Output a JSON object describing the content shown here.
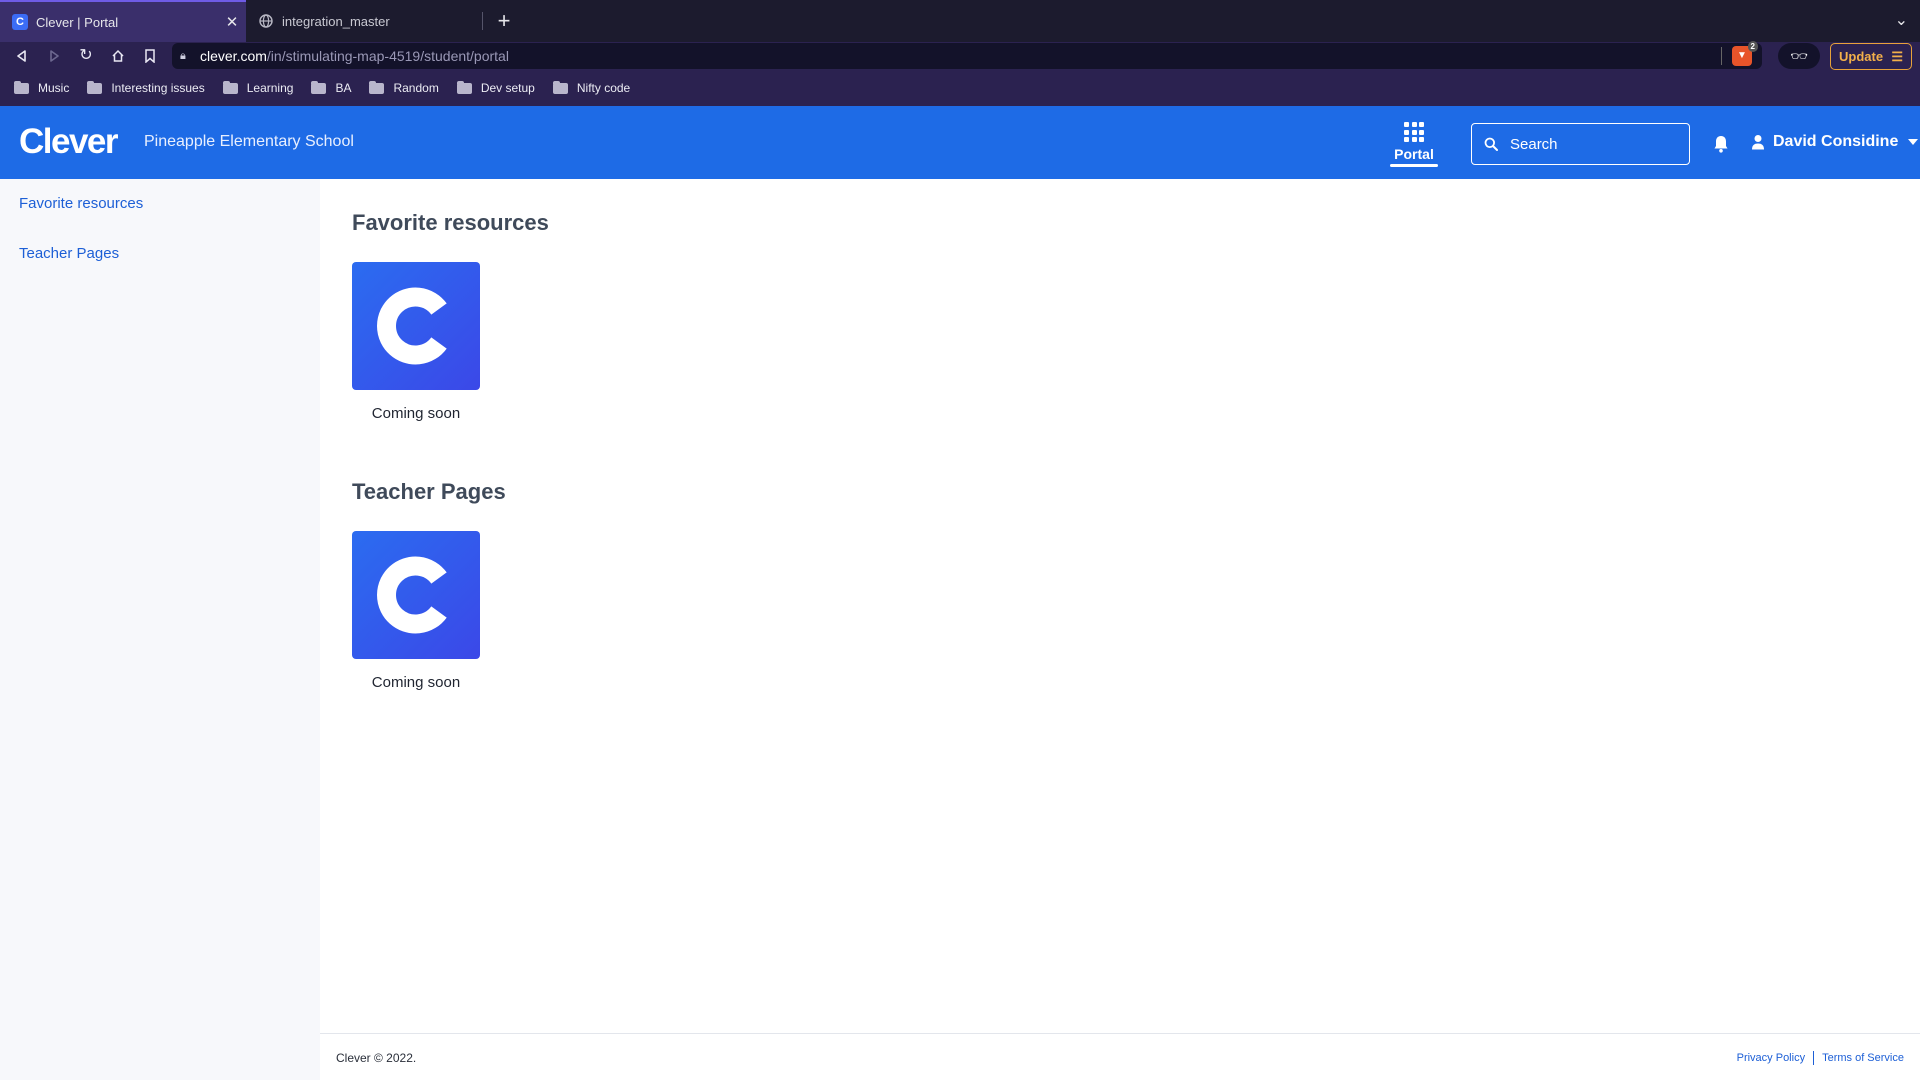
{
  "browser": {
    "tabs": [
      {
        "title": "Clever | Portal",
        "favicon": "C",
        "active": true
      },
      {
        "title": "integration_master",
        "favicon": "globe-icon",
        "active": false
      }
    ],
    "url_host": "clever.com",
    "url_path": "/in/stimulating-map-4519/student/portal",
    "shield_count": "2",
    "update_label": "Update",
    "bookmarks": [
      "Music",
      "Interesting issues",
      "Learning",
      "BA",
      "Random",
      "Dev setup",
      "Nifty code"
    ]
  },
  "header": {
    "logo": "Clever",
    "school": "Pineapple Elementary School",
    "portal_label": "Portal",
    "search_placeholder": "Search",
    "user_name": "David Considine",
    "brand_color": "#1e6be6"
  },
  "sidebar": {
    "items": [
      {
        "label": "Favorite resources"
      },
      {
        "label": "Teacher Pages"
      }
    ]
  },
  "sections": [
    {
      "title": "Favorite resources",
      "tiles": [
        {
          "label": "Coming soon"
        }
      ]
    },
    {
      "title": "Teacher Pages",
      "tiles": [
        {
          "label": "Coming soon"
        }
      ]
    }
  ],
  "footer": {
    "copyright": "Clever © 2022.",
    "privacy": "Privacy Policy",
    "terms": "Terms of Service"
  }
}
